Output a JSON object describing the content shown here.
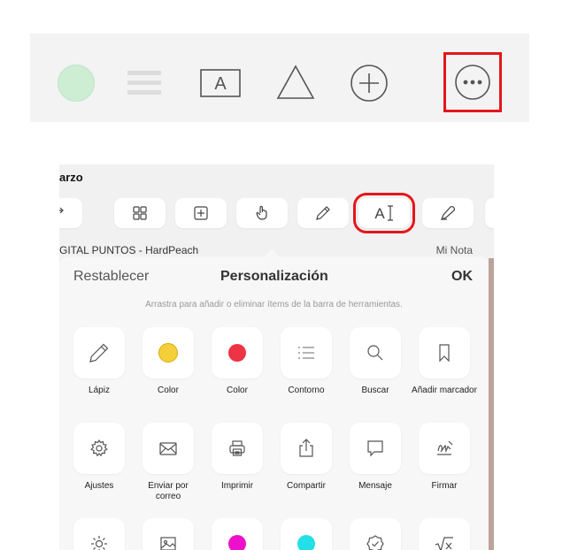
{
  "toolbar": {
    "items": [
      "color-swatch",
      "lines-icon",
      "text-box-icon",
      "triangle-icon",
      "add-icon",
      "more-icon"
    ],
    "swatch_color": "#cdeed2",
    "highlight_color": "#e4161b"
  },
  "panel": {
    "title": "arzo",
    "subheader_left": "GITAL PUNTOS - HardPeach",
    "subheader_right": "Mi Nota",
    "tools": [
      "redo-icon",
      "grid-icon",
      "add-page-icon",
      "hand-icon",
      "pencil-icon",
      "text-cursor-icon",
      "eraser-icon"
    ]
  },
  "sheet": {
    "reset_label": "Restablecer",
    "title": "Personalización",
    "ok_label": "OK",
    "hint": "Arrastra para añadir o eliminar ítems de la barra de herramientas."
  },
  "grid": {
    "row1": [
      "Lápiz",
      "Color",
      "Color",
      "Contorno",
      "Buscar",
      "Añadir marcador"
    ],
    "row2": [
      "Ajustes",
      "Enviar por correo",
      "Imprimir",
      "Compartir",
      "Mensaje",
      "Firmar"
    ]
  },
  "colors": {
    "yellow": "#f5cf3a",
    "red": "#ee3344",
    "magenta": "#ee11cc",
    "cyan": "#22e0e6"
  }
}
